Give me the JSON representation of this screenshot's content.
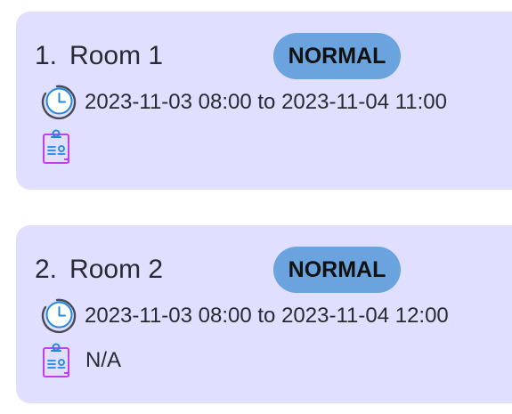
{
  "rooms": [
    {
      "index": "1.",
      "name": "Room 1",
      "status": "NORMAL",
      "time_range": "2023-11-03 08:00 to 2023-11-04 11:00",
      "notes": "",
      "clock_icon": "clock-icon",
      "notes_icon": "clipboard-icon"
    },
    {
      "index": "2.",
      "name": "Room 2",
      "status": "NORMAL",
      "time_range": "2023-11-03 08:00 to 2023-11-04 12:00",
      "notes": "N/A",
      "clock_icon": "clock-icon",
      "notes_icon": "clipboard-icon"
    }
  ],
  "colors": {
    "card_background": "#e0dfff",
    "badge_background": "#6aa3dd",
    "clock_stroke": "#4a4a55",
    "clock_face": "#1e88e5",
    "notes_icon": "#c23cf0",
    "text": "#2a2a33"
  }
}
